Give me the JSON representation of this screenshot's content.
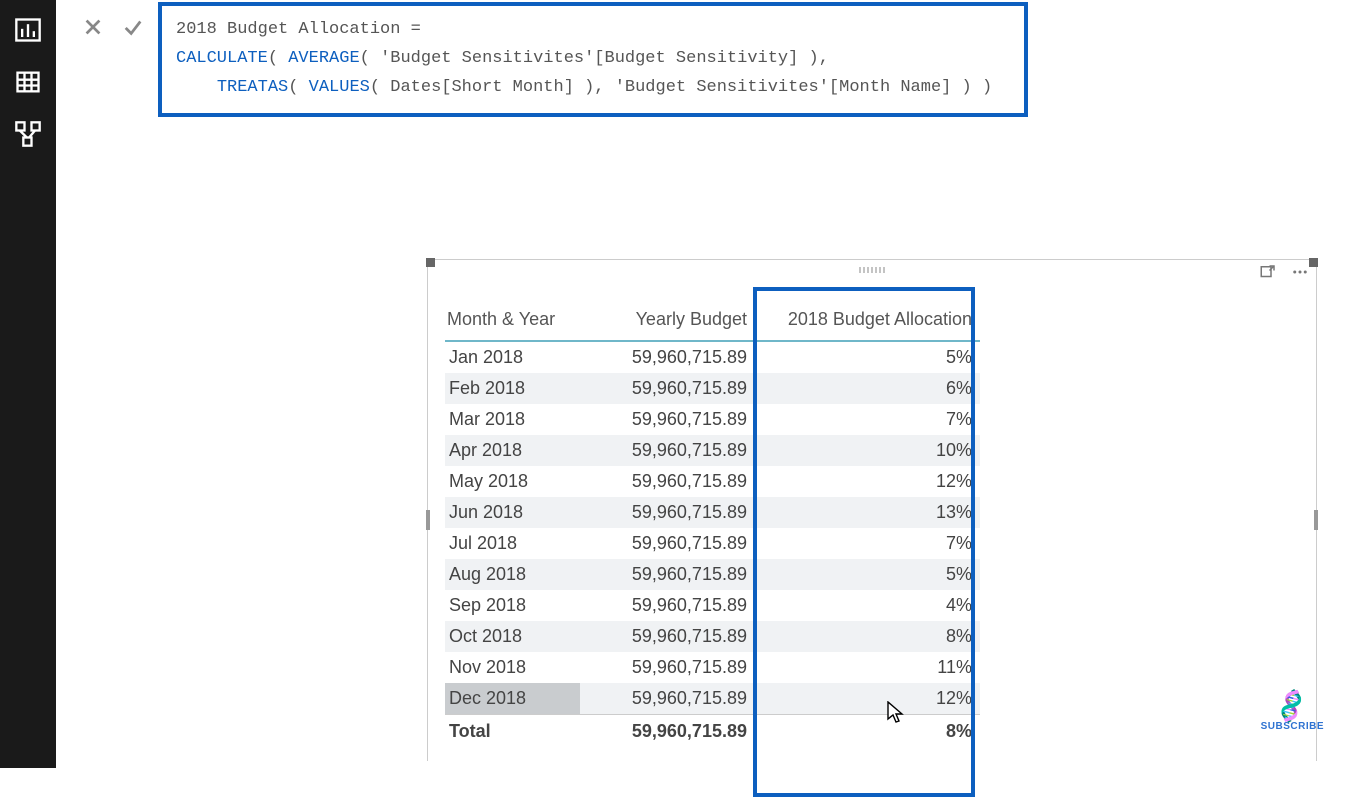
{
  "formula": {
    "line1_measure": "2018 Budget Allocation",
    "eq": " = ",
    "line2_pre": "",
    "fn_calculate": "CALCULATE",
    "paren_o1": "( ",
    "fn_average": "AVERAGE",
    "paren_o2": "( ",
    "arg_avg": "'Budget Sensitivites'[Budget Sensitivity] ),",
    "line3_indent": "    ",
    "fn_treatas": "TREATAS",
    "paren_o3": "( ",
    "fn_values": "VALUES",
    "paren_o4": "( ",
    "arg_values": "Dates[Short Month] ), 'Budget Sensitivites'[Month Name] ) )"
  },
  "table": {
    "headers": {
      "month": "Month & Year",
      "budget": "Yearly Budget",
      "alloc": "2018 Budget Allocation"
    },
    "rows": [
      {
        "month": "Jan 2018",
        "budget": "59,960,715.89",
        "alloc": "5%"
      },
      {
        "month": "Feb 2018",
        "budget": "59,960,715.89",
        "alloc": "6%"
      },
      {
        "month": "Mar 2018",
        "budget": "59,960,715.89",
        "alloc": "7%"
      },
      {
        "month": "Apr 2018",
        "budget": "59,960,715.89",
        "alloc": "10%"
      },
      {
        "month": "May 2018",
        "budget": "59,960,715.89",
        "alloc": "12%"
      },
      {
        "month": "Jun 2018",
        "budget": "59,960,715.89",
        "alloc": "13%"
      },
      {
        "month": "Jul 2018",
        "budget": "59,960,715.89",
        "alloc": "7%"
      },
      {
        "month": "Aug 2018",
        "budget": "59,960,715.89",
        "alloc": "5%"
      },
      {
        "month": "Sep 2018",
        "budget": "59,960,715.89",
        "alloc": "4%"
      },
      {
        "month": "Oct 2018",
        "budget": "59,960,715.89",
        "alloc": "8%"
      },
      {
        "month": "Nov 2018",
        "budget": "59,960,715.89",
        "alloc": "11%"
      },
      {
        "month": "Dec 2018",
        "budget": "59,960,715.89",
        "alloc": "12%"
      }
    ],
    "total": {
      "label": "Total",
      "budget": "59,960,715.89",
      "alloc": "8%"
    }
  },
  "badge": {
    "label": "SUBSCRIBE"
  },
  "chart_data": {
    "type": "table",
    "title": "2018 Budget Allocation by Month",
    "columns": [
      "Month & Year",
      "Yearly Budget",
      "2018 Budget Allocation"
    ],
    "categories": [
      "Jan 2018",
      "Feb 2018",
      "Mar 2018",
      "Apr 2018",
      "May 2018",
      "Jun 2018",
      "Jul 2018",
      "Aug 2018",
      "Sep 2018",
      "Oct 2018",
      "Nov 2018",
      "Dec 2018"
    ],
    "series": [
      {
        "name": "Yearly Budget",
        "values": [
          59960715.89,
          59960715.89,
          59960715.89,
          59960715.89,
          59960715.89,
          59960715.89,
          59960715.89,
          59960715.89,
          59960715.89,
          59960715.89,
          59960715.89,
          59960715.89
        ]
      },
      {
        "name": "2018 Budget Allocation (%)",
        "values": [
          5,
          6,
          7,
          10,
          12,
          13,
          7,
          5,
          4,
          8,
          11,
          12
        ]
      }
    ],
    "totals": {
      "Yearly Budget": 59960715.89,
      "2018 Budget Allocation (%)": 8
    }
  }
}
